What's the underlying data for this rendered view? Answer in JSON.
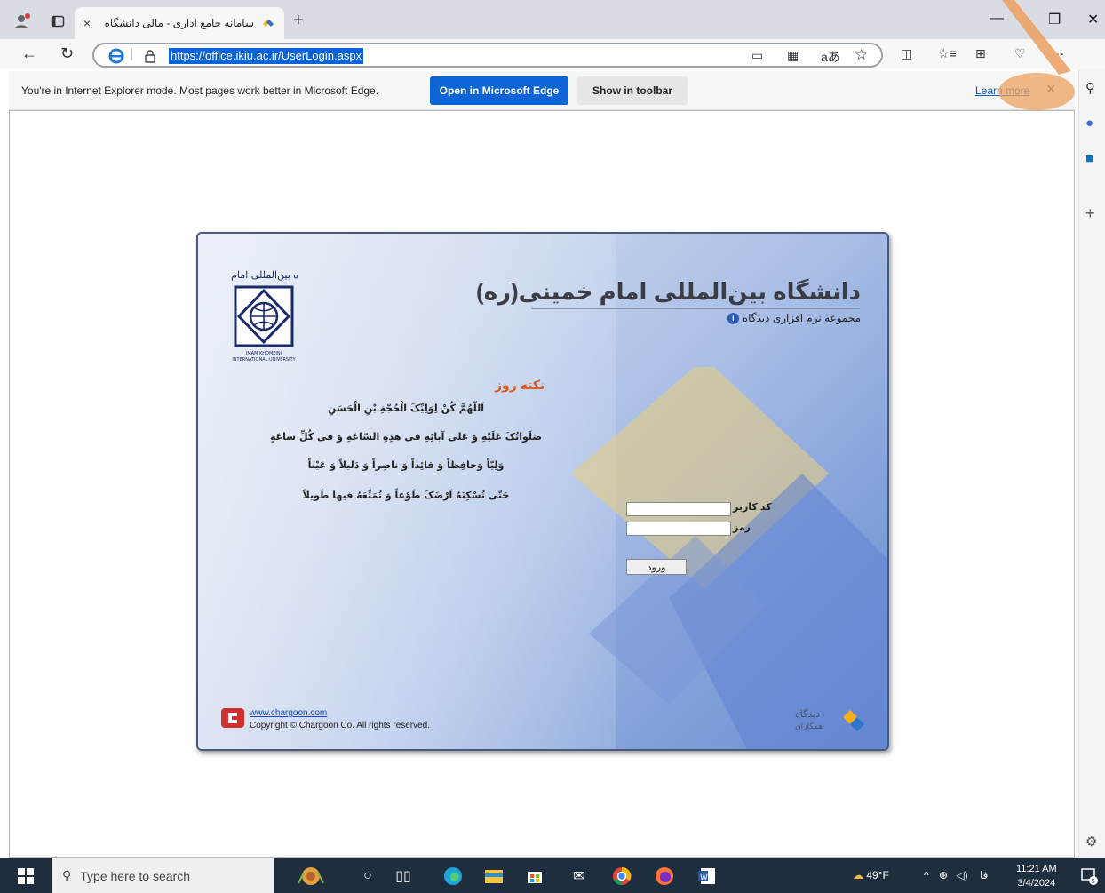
{
  "browser": {
    "tab_title": "سامانه جامع اداری - مالی دانشگاه",
    "tab_close": "×",
    "new_tab": "+",
    "url": "https://office.ikiu.ac.ir/UserLogin.aspx"
  },
  "infobar": {
    "message": "You're in Internet Explorer mode. Most pages work better in Microsoft Edge.",
    "open_edge": "Open in Microsoft Edge",
    "show_toolbar": "Show in toolbar",
    "learn_more": "Learn more",
    "close": "×"
  },
  "page": {
    "university_name": "دانشگاه بین‌المللی امام خمینی(ره)",
    "subtitle": "مجموعه نرم افزاری دیدگاه",
    "note_title": "نکته روز",
    "prayer_lines": [
      "اَللّهُمَّ کُنْ لِوَلِیِّکَ الْحُجَّةِ بْنِ الْحَسَنِ",
      "صَلَواتُکَ عَلَیْهِ وَ عَلی آبائِهِ فی هذِهِ السّاعَةِ وَ فی کُلِّ ساعَةٍ",
      "وَلِیّاً وَحافِظاً وَ قائِداً وَ ناصِراً وَ دَلیلاً وَ عَیْناً",
      "حَتّی تُسْکِنَهُ اَرْضَکَ طَوْعاً وَ تُمَتِّعَهُ فیها طَویلاً"
    ],
    "user_label": "کد کاربر",
    "pass_label": "رمز",
    "login_button": "ورود",
    "footer_link": "www.chargoon.com",
    "footer_copyright": "Copyright © Chargoon Co. All rights reserved."
  },
  "taskbar": {
    "search_placeholder": "Type here to search",
    "weather": "49°F",
    "lang": "فا",
    "time": "11:21 AM",
    "date": "3/4/2024",
    "notifications": "5"
  },
  "colors": {
    "accent": "#0d64d6",
    "note_title": "#d8581e",
    "highlight": "#eca060"
  }
}
